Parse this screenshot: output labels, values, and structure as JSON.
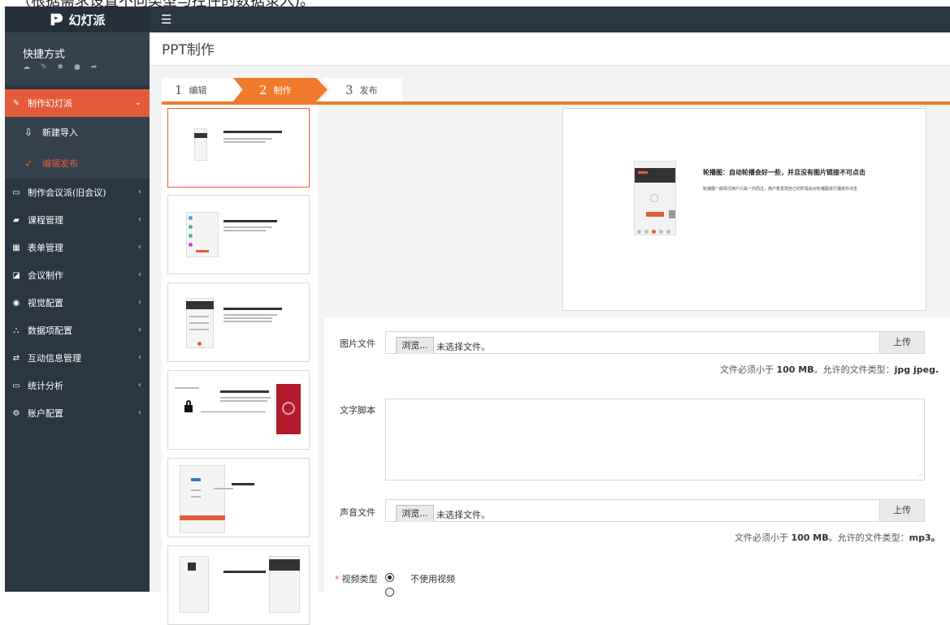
{
  "app": {
    "logo_text": "幻灯派"
  },
  "shortcut": {
    "title": "快捷方式",
    "icons": [
      "cloud-icon",
      "edit-icon",
      "gear-icon",
      "chat-icon",
      "logout-icon"
    ]
  },
  "menu": {
    "active": {
      "label": "制作幻灯派",
      "icon": "edit-icon"
    },
    "subitems": [
      {
        "label": "新建导入",
        "icon": "upload-icon"
      },
      {
        "label": "编辑发布",
        "icon": "rocket-icon"
      }
    ],
    "items": [
      {
        "label": "制作会议派(旧会议)",
        "icon": "laptop-icon"
      },
      {
        "label": "课程管理",
        "icon": "book-icon"
      },
      {
        "label": "表单管理",
        "icon": "table-icon"
      },
      {
        "label": "会议制作",
        "icon": "edit-icon"
      },
      {
        "label": "视觉配置",
        "icon": "eye-icon"
      },
      {
        "label": "数据项配置",
        "icon": "sitemap-icon"
      },
      {
        "label": "互动信息管理",
        "icon": "exchange-icon"
      },
      {
        "label": "统计分析",
        "icon": "monitor-icon"
      },
      {
        "label": "账户配置",
        "icon": "cogs-icon"
      }
    ]
  },
  "page": {
    "title": "PPT制作"
  },
  "steps": [
    {
      "num": "1",
      "label": "编辑"
    },
    {
      "num": "2",
      "label": "制作"
    },
    {
      "num": "3",
      "label": "发布"
    }
  ],
  "preview": {
    "title": "轮播图：自动轮播会好一些，并且没有图片链接不可点击",
    "desc": "轮播图一般情况用户只是一扫而过，用户若发现自己的所需会对轮播图进行播放并点击"
  },
  "form": {
    "image_label": "图片文件",
    "browse_label": "浏览...",
    "no_file": "未选择文件。",
    "upload_label": "上传",
    "image_hint_pre": "文件必须小于 ",
    "image_hint_size": "100 MB",
    "image_hint_mid": "。允许的文件类型：",
    "image_hint_types": "jpg jpeg.",
    "script_label": "文字脚本",
    "audio_label": "声音文件",
    "audio_hint_pre": "文件必须小于 ",
    "audio_hint_size": "100 MB",
    "audio_hint_mid": "。允许的文件类型：",
    "audio_hint_types": "mp3。",
    "video_required": "*",
    "video_label": "视频类型",
    "video_option_1": "不使用视频"
  },
  "colors": {
    "accent": "#e35b3a",
    "step_active": "#f07a2c",
    "sidebar": "#2b3643"
  }
}
